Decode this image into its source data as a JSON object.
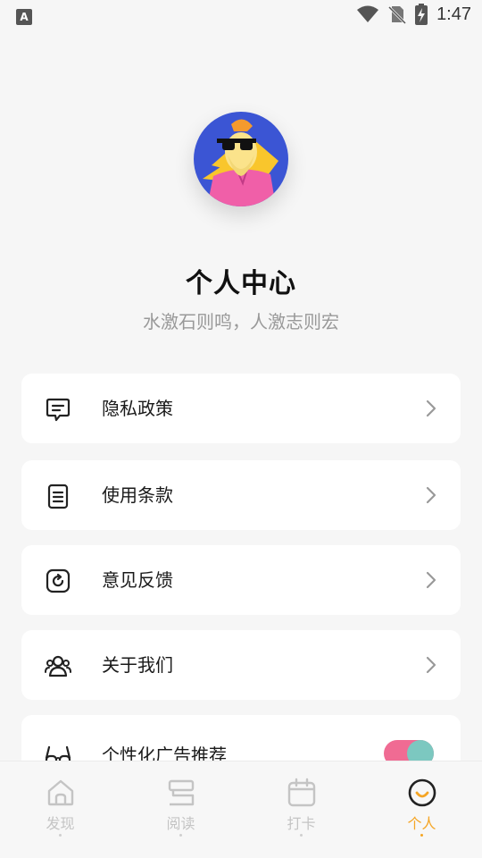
{
  "status_bar": {
    "time": "1:47",
    "left_icon": "A"
  },
  "profile": {
    "title": "个人中心",
    "subtitle": "水激石则鸣，人激志则宏"
  },
  "menu": [
    {
      "label": "隐私政策",
      "icon": "message-square-icon"
    },
    {
      "label": "使用条款",
      "icon": "document-icon"
    },
    {
      "label": "意见反馈",
      "icon": "refresh-square-icon"
    },
    {
      "label": "关于我们",
      "icon": "users-icon"
    },
    {
      "label": "个性化广告推荐",
      "icon": "glasses-icon",
      "toggle_on": true
    }
  ],
  "tabs": [
    {
      "label": "发现",
      "icon": "home-icon"
    },
    {
      "label": "阅读",
      "icon": "book-icon"
    },
    {
      "label": "打卡",
      "icon": "calendar-icon"
    },
    {
      "label": "个人",
      "icon": "smile-face-icon",
      "active": true
    }
  ],
  "colors": {
    "accent": "#f5a524",
    "toggle_track": "#f06b93",
    "toggle_knob": "#7cc8c0",
    "avatar_bg": "#3b55d4"
  }
}
